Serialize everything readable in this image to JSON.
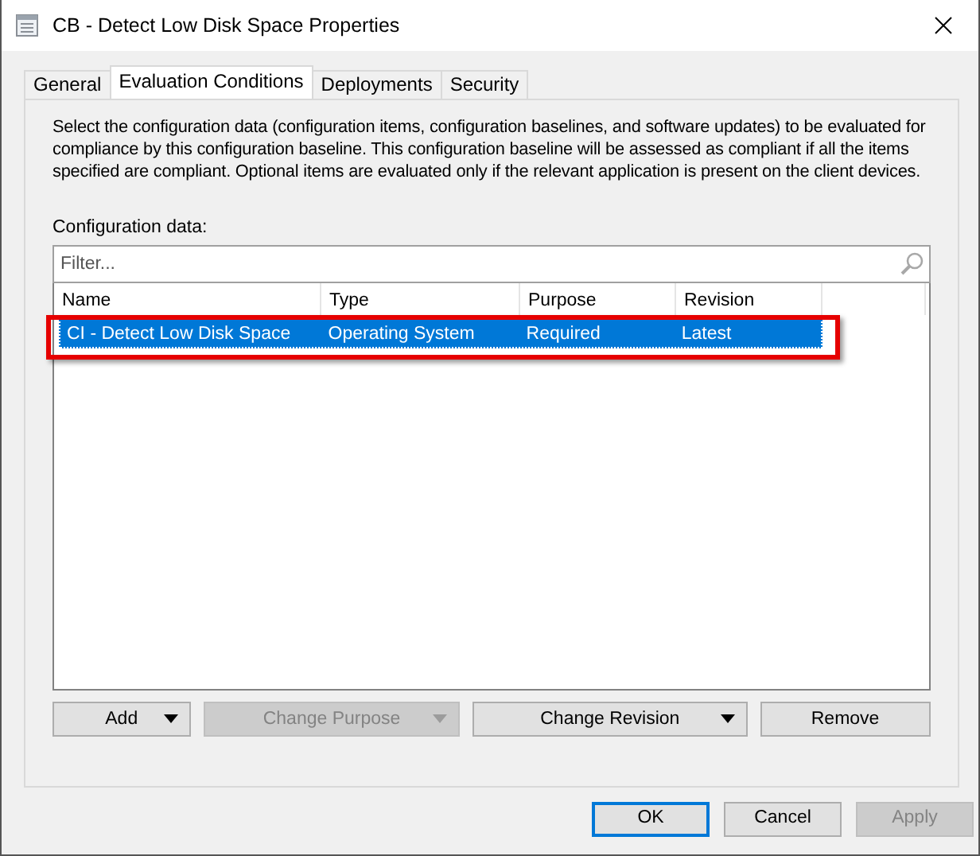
{
  "window": {
    "title": "CB - Detect Low Disk Space Properties"
  },
  "tabs": [
    {
      "label": "General",
      "selected": false
    },
    {
      "label": "Evaluation Conditions",
      "selected": true
    },
    {
      "label": "Deployments",
      "selected": false
    },
    {
      "label": "Security",
      "selected": false
    }
  ],
  "description": "Select the configuration data (configuration items, configuration baselines, and software updates) to be evaluated for compliance by this configuration baseline. This configuration baseline will be assessed as compliant if all the items specified are compliant. Optional items are evaluated only if the relevant application is present on  the client devices.",
  "config_label": "Configuration data:",
  "filter": {
    "placeholder": "Filter..."
  },
  "table": {
    "columns": [
      "Name",
      "Type",
      "Purpose",
      "Revision"
    ],
    "rows": [
      {
        "cells": [
          "CI - Detect Low Disk Space",
          "Operating System",
          "Required",
          "Latest"
        ],
        "selected": true,
        "highlighted": true
      }
    ]
  },
  "actions": [
    {
      "label": "Add",
      "dropdown": true,
      "disabled": false
    },
    {
      "label": "Change Purpose",
      "dropdown": true,
      "disabled": true
    },
    {
      "label": "Change Revision",
      "dropdown": true,
      "disabled": false
    },
    {
      "label": "Remove",
      "dropdown": false,
      "disabled": false
    }
  ],
  "dialog_buttons": [
    {
      "label": "OK",
      "default": true,
      "disabled": false
    },
    {
      "label": "Cancel",
      "default": false,
      "disabled": false
    },
    {
      "label": "Apply",
      "default": false,
      "disabled": true
    }
  ]
}
